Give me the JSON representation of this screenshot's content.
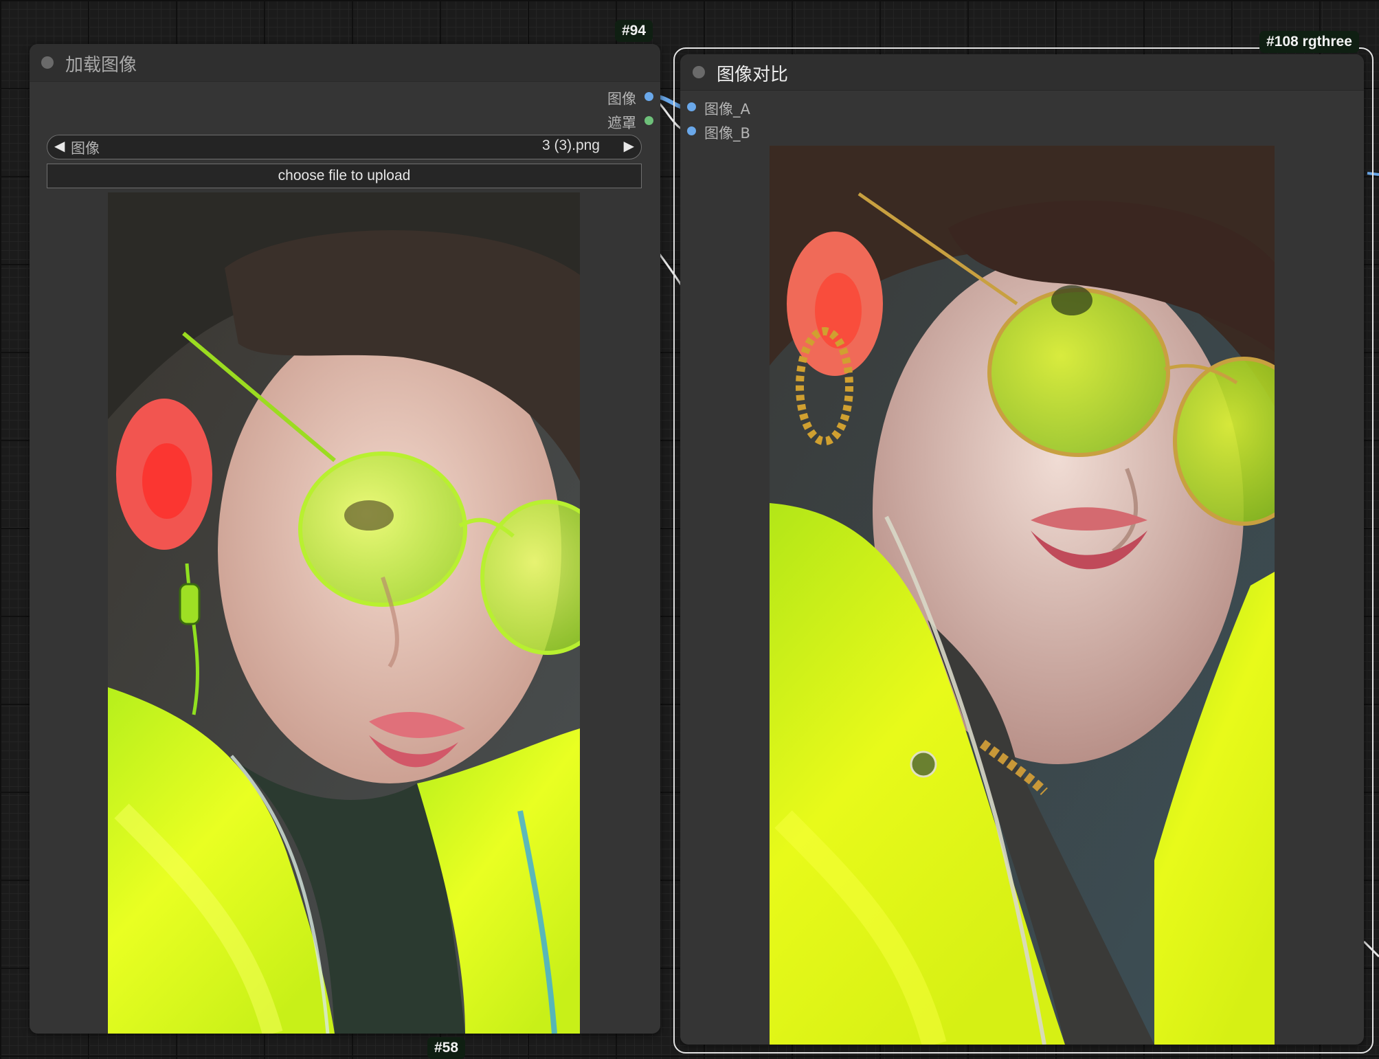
{
  "canvas": {
    "load_node": {
      "badge": "#94",
      "title": "加载图像",
      "outputs": [
        {
          "label": "图像",
          "color": "#6aa8ea"
        },
        {
          "label": "遮罩",
          "color": "#6ec07a"
        }
      ],
      "image_widget": {
        "name": "图像",
        "value": "3 (3).png"
      },
      "upload_label": "choose file to upload",
      "bottom_badge": "#58"
    },
    "compare_node": {
      "badge": "#108 rgthree",
      "title": "图像对比",
      "inputs": [
        {
          "label": "图像_A",
          "color": "#6aa8ea"
        },
        {
          "label": "图像_B",
          "color": "#6aa8ea"
        }
      ]
    }
  },
  "colors": {
    "node_body": "#353535",
    "node_header": "#2f2f2f",
    "image_link": "#6aa8ea",
    "mask_link": "#6ec07a",
    "selection_outline": "#e6e6e6",
    "badge_bg": "#0f1f12"
  }
}
